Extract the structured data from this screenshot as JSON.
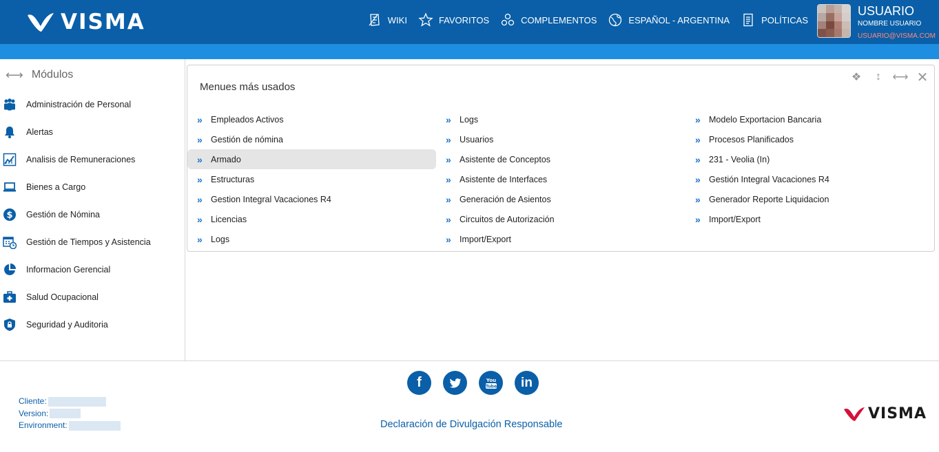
{
  "header": {
    "brand": "VISMA",
    "nav": [
      {
        "label": "WIKI",
        "icon": "wiki-icon"
      },
      {
        "label": "FAVORITOS",
        "icon": "star-icon"
      },
      {
        "label": "COMPLEMENTOS",
        "icon": "puzzle-icon"
      },
      {
        "label": "ESPAÑOL - ARGENTINA",
        "icon": "globe-icon"
      },
      {
        "label": "POLÍTICAS",
        "icon": "document-icon"
      }
    ],
    "user": {
      "name": "USUARIO",
      "subtitle": "NOMBRE USUARIO",
      "email": "USUARIO@VISMA.COM"
    }
  },
  "sidebar": {
    "title": "Módulos",
    "items": [
      {
        "label": "Administración de Personal",
        "icon": "people-icon"
      },
      {
        "label": "Alertas",
        "icon": "bell-icon"
      },
      {
        "label": "Analisis de Remuneraciones",
        "icon": "chart-icon"
      },
      {
        "label": "Bienes a Cargo",
        "icon": "laptop-icon"
      },
      {
        "label": "Gestión de Nómina",
        "icon": "dollar-icon"
      },
      {
        "label": "Gestión de Tiempos y Asistencia",
        "icon": "calendar-clock-icon"
      },
      {
        "label": "Informacion Gerencial",
        "icon": "pie-chart-icon"
      },
      {
        "label": "Salud Ocupacional",
        "icon": "medical-kit-icon"
      },
      {
        "label": "Seguridad y Auditoria",
        "icon": "lock-shield-icon"
      }
    ]
  },
  "panel": {
    "title": "Menues más usados",
    "columns": [
      [
        "Empleados Activos",
        "Gestión de nómina",
        "Armado",
        "Estructuras",
        "Gestion Integral Vacaciones R4",
        "Licencias",
        "Logs"
      ],
      [
        "Logs",
        "Usuarios",
        "Asistente de Conceptos",
        "Asistente de Interfaces",
        "Generación de Asientos",
        "Circuitos de Autorización",
        "Import/Export"
      ],
      [
        "Modelo Exportacion Bancaria",
        "Procesos Planificados",
        "231 - Veolia (In)",
        "Gestión Integral Vacaciones R4",
        "Generador Reporte Liquidacion",
        "Import/Export"
      ]
    ]
  },
  "footer": {
    "client_label": "Cliente:",
    "version_label": "Version:",
    "environment_label": "Environment:",
    "disclosure": "Declaración de Divulgación Responsable",
    "brand": "VISMA",
    "socials": [
      "facebook-icon",
      "twitter-icon",
      "youtube-icon",
      "linkedin-icon"
    ]
  },
  "colors": {
    "header": "#0a5fa8",
    "subbar": "#1e8fe0",
    "accent": "#1a74c8",
    "brand_red": "#d3123a"
  }
}
